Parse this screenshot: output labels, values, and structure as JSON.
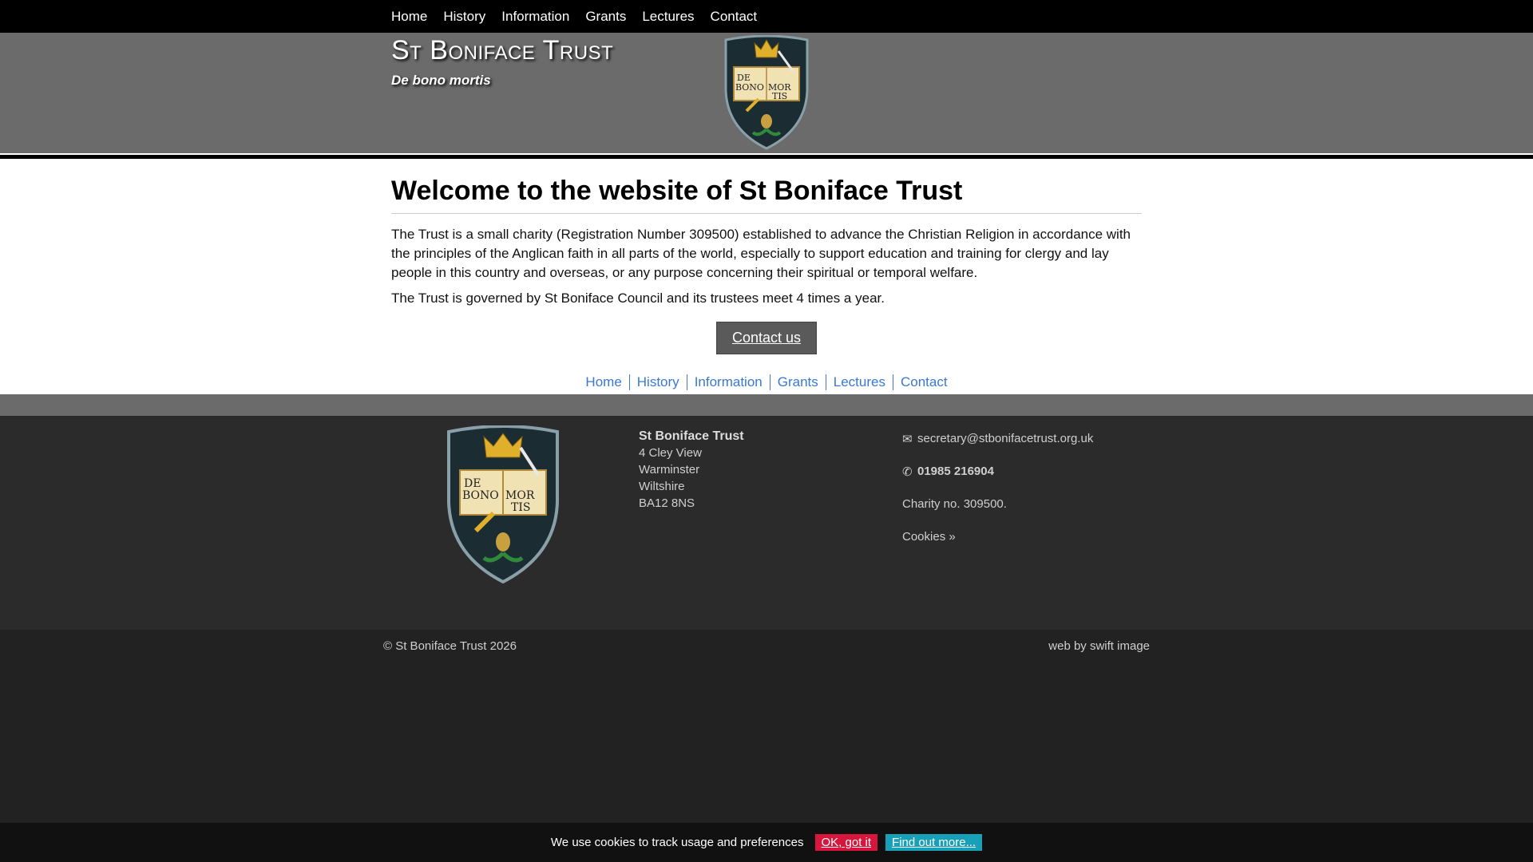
{
  "nav": {
    "items": [
      {
        "label": "Home"
      },
      {
        "label": "History"
      },
      {
        "label": "Information"
      },
      {
        "label": "Grants"
      },
      {
        "label": "Lectures"
      },
      {
        "label": "Contact"
      }
    ]
  },
  "header": {
    "title": "St Boniface Trust",
    "motto": "De bono mortis",
    "shield_text": [
      "DE",
      "BONO",
      "MOR",
      "TIS"
    ]
  },
  "main": {
    "title": "Welcome to the website of St Boniface Trust",
    "paragraph1": "The Trust is a small charity (Registration Number 309500) established to advance the Christian Religion in accordance with the principles of the Anglican faith in all parts of the world, especially to support education and training for clergy and lay people in this country and overseas, or any purpose concerning their spiritual or temporal welfare.",
    "paragraph2": "The Trust is governed by St Boniface Council and its trustees meet 4 times a year.",
    "contact_button": "Contact us"
  },
  "footer": {
    "address": {
      "org": "St Boniface Trust",
      "line1": "4 Cley View",
      "line2": "Warminster",
      "line3": "Wiltshire",
      "line4": "BA12 8NS"
    },
    "email": "secretary@stbonifacetrust.org.uk",
    "phone": "01985 216904",
    "charity": "Charity no. 309500.",
    "cookies_link": "Cookies »",
    "copyright": "© St Boniface Trust 2026",
    "credit": "web by swift image"
  },
  "cookie_bar": {
    "message": "We use cookies to track usage and preferences",
    "ok": "OK, got it",
    "more": "Find out more..."
  },
  "colors": {
    "nav_bg": "#000000",
    "header_bg": "#6b6b6b",
    "link_blue": "#3a78d4",
    "footer_bg": "#2b2b2b",
    "ok_red": "#d6163c",
    "more_teal": "#18a0b8"
  }
}
